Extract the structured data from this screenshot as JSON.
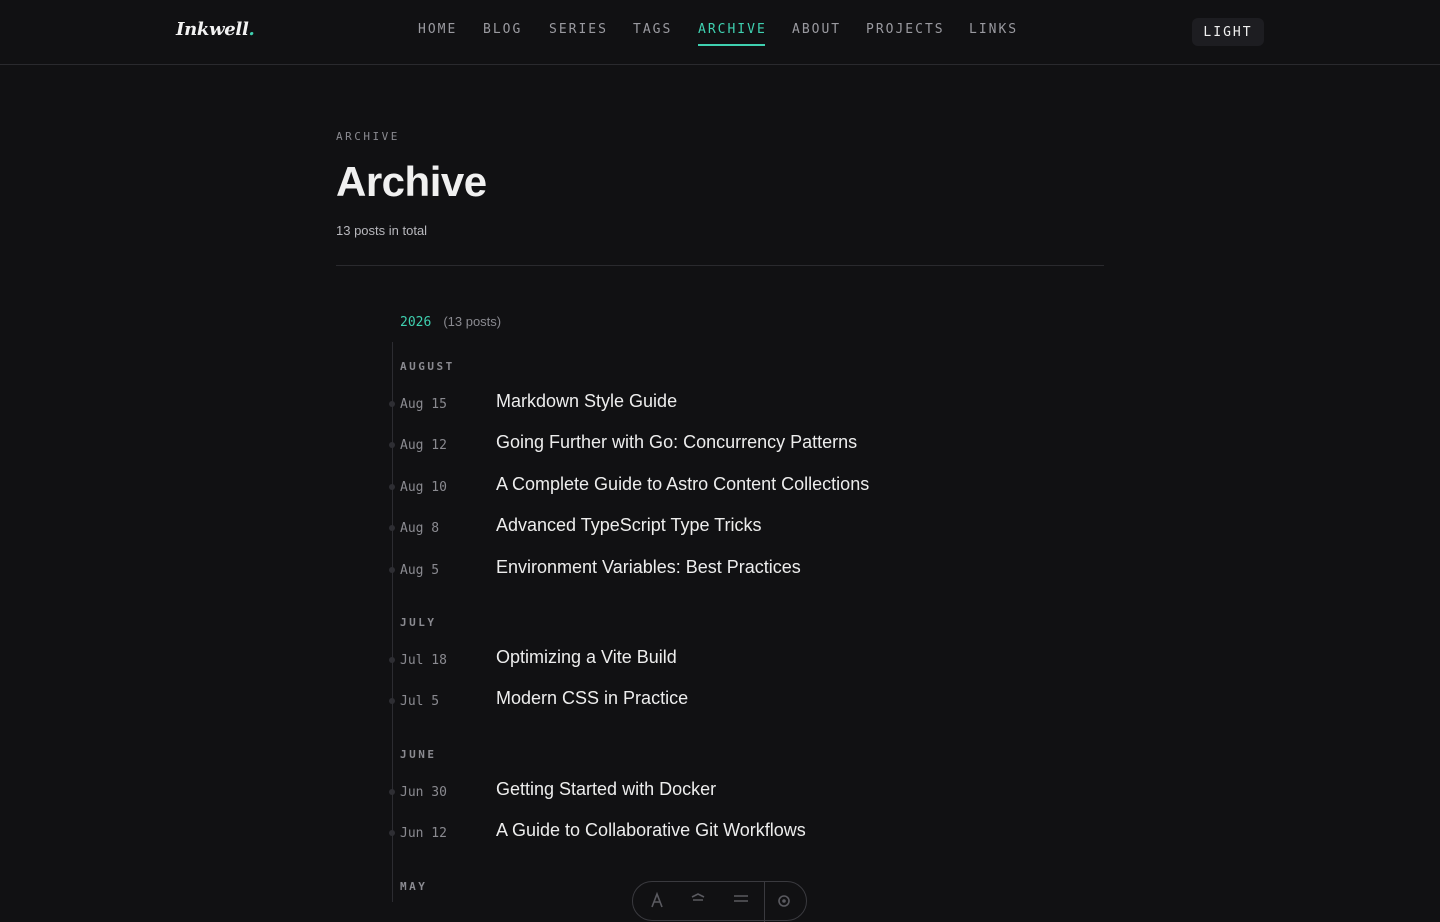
{
  "brand": {
    "name": "Inkwell",
    "dot": "."
  },
  "nav": {
    "items": [
      {
        "label": "HOME"
      },
      {
        "label": "BLOG"
      },
      {
        "label": "SERIES"
      },
      {
        "label": "TAGS"
      },
      {
        "label": "ARCHIVE",
        "active": true
      },
      {
        "label": "ABOUT"
      },
      {
        "label": "PROJECTS"
      },
      {
        "label": "LINKS"
      }
    ],
    "theme_toggle": "LIGHT"
  },
  "page": {
    "eyebrow": "ARCHIVE",
    "title": "Archive",
    "subtitle": "13 posts in total"
  },
  "archive": {
    "year": "2026",
    "year_count": "(13 posts)",
    "months": [
      {
        "name": "AUGUST",
        "posts": [
          {
            "date": "Aug 15",
            "title": "Markdown Style Guide"
          },
          {
            "date": "Aug 12",
            "title": "Going Further with Go: Concurrency Patterns"
          },
          {
            "date": "Aug 10",
            "title": "A Complete Guide to Astro Content Collections"
          },
          {
            "date": "Aug 8",
            "title": "Advanced TypeScript Type Tricks"
          },
          {
            "date": "Aug 5",
            "title": "Environment Variables: Best Practices"
          }
        ]
      },
      {
        "name": "JULY",
        "posts": [
          {
            "date": "Jul 18",
            "title": "Optimizing a Vite Build"
          },
          {
            "date": "Jul 5",
            "title": "Modern CSS in Practice"
          }
        ]
      },
      {
        "name": "JUNE",
        "posts": [
          {
            "date": "Jun 30",
            "title": "Getting Started with Docker"
          },
          {
            "date": "Jun 12",
            "title": "A Guide to Collaborative Git Workflows"
          }
        ]
      },
      {
        "name": "MAY",
        "posts": []
      }
    ]
  },
  "colors": {
    "background": "#111113",
    "accent": "#3fd0b0",
    "muted": "#8a8a90",
    "text": "#ededed"
  },
  "floating_toolbar": {
    "icons": [
      "font-icon",
      "broom-icon",
      "menu-icon",
      "settings-icon"
    ]
  }
}
